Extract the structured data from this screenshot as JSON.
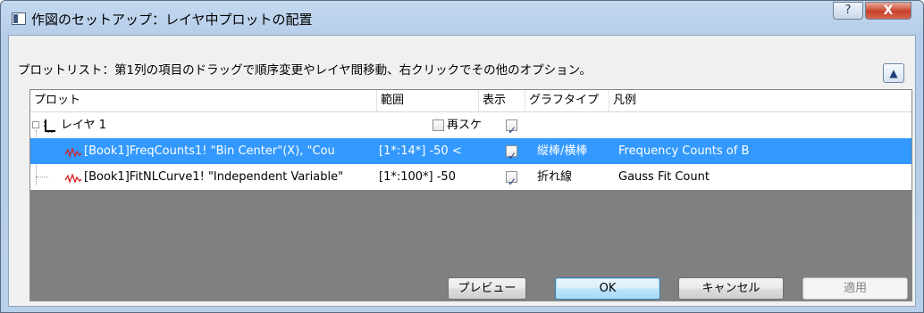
{
  "window": {
    "title": "作図のセットアップ：レイヤ中プロットの配置",
    "help_label": "?",
    "close_label": "X"
  },
  "hint": "プロットリスト：第1列の項目のドラッグで順序変更やレイヤ間移動、右クリックでその他のオプション。",
  "collapse_label": "≫",
  "columns": [
    "プロット",
    "範囲",
    "表示",
    "グラフタイプ",
    "凡例"
  ],
  "layer": {
    "label": "レイヤ 1",
    "rescale_label": "再スケ",
    "rescale_checked": false,
    "show_checked": true
  },
  "plots": [
    {
      "name": "[Book1]FreqCounts1! \"Bin Center\"(X), \"Cou",
      "range": "[1*:14*]  -50 <",
      "show": true,
      "type": "縦棒/横棒",
      "legend": "Frequency Counts of B",
      "selected": true
    },
    {
      "name": "[Book1]FitNLCurve1! \"Independent Variable\"",
      "range": "[1*:100*]  -50",
      "show": true,
      "type": "折れ線",
      "legend": "Gauss Fit Count",
      "selected": false
    }
  ],
  "buttons": {
    "preview": "プレビュー",
    "ok": "OK",
    "cancel": "キャンセル",
    "apply": "適用"
  },
  "colors": {
    "selection": "#3399ff",
    "plot_icon": "#d62020"
  }
}
